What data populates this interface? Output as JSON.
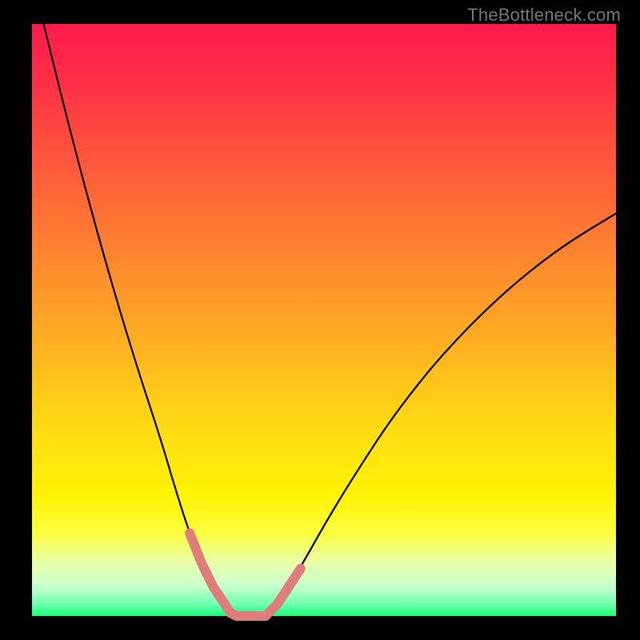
{
  "watermark": "TheBottleneck.com",
  "colors": {
    "frame_bg": "#000000",
    "gradient_stops": [
      "#ff1a4b",
      "#ff2a47",
      "#ff4840",
      "#ff6b36",
      "#ff8e2c",
      "#ffb321",
      "#ffd516",
      "#ffe80d",
      "#fff405",
      "#fbff3e",
      "#e9ffa8",
      "#c8ffd0",
      "#6fffb0",
      "#17ff7a"
    ],
    "curve_stroke": "#000000",
    "highlight_stroke": "#de7d7a"
  },
  "chart_data": {
    "type": "line",
    "title": "",
    "xlabel": "",
    "ylabel": "",
    "xlim": [
      0,
      100
    ],
    "ylim": [
      0,
      100
    ],
    "series": [
      {
        "name": "left_curve",
        "x": [
          2,
          6,
          10,
          14,
          18,
          22,
          25,
          27,
          29,
          31,
          33,
          34,
          35
        ],
        "y": [
          100,
          84,
          69,
          55,
          42,
          30,
          20,
          14,
          9,
          5,
          2,
          0.5,
          0
        ]
      },
      {
        "name": "right_curve",
        "x": [
          40,
          42,
          44,
          47,
          51,
          56,
          62,
          70,
          80,
          90,
          100
        ],
        "y": [
          0,
          2,
          5,
          10,
          17,
          25,
          34,
          44,
          54,
          62,
          68
        ]
      }
    ],
    "highlight_points": {
      "name": "pink_overlay",
      "x": [
        27,
        29,
        31,
        33,
        34,
        35,
        36,
        38,
        40,
        42,
        44,
        46
      ],
      "y": [
        14,
        9,
        5,
        2,
        0.5,
        0,
        0,
        0,
        0,
        2,
        5,
        8
      ]
    }
  }
}
